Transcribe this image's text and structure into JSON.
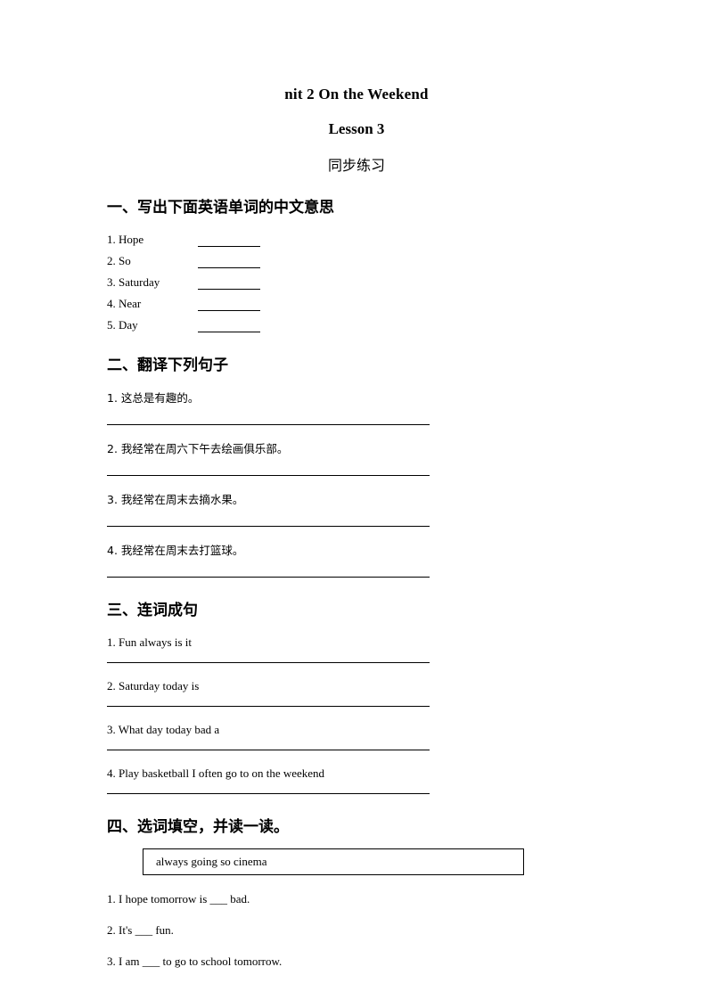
{
  "document": {
    "title": "nit 2 On the Weekend",
    "subtitle": "Lesson 3",
    "subtitle2": "同步练习"
  },
  "section1": {
    "heading": "一、写出下面英语单词的中文意思",
    "items": [
      {
        "number": "1.",
        "word": "Hope"
      },
      {
        "number": "2.",
        "word": "So"
      },
      {
        "number": "3.",
        "word": "Saturday"
      },
      {
        "number": "4.",
        "word": "Near"
      },
      {
        "number": "5.",
        "word": "Day"
      }
    ]
  },
  "section2": {
    "heading": "二、翻译下列句子",
    "items": [
      "1. 这总是有趣的。",
      "2. 我经常在周六下午去绘画俱乐部。",
      "3. 我经常在周末去摘水果。",
      "4. 我经常在周末去打篮球。"
    ]
  },
  "section3": {
    "heading": "三、连词成句",
    "items": [
      "1. Fun always is it",
      "2. Saturday today is",
      "3. What day today bad a",
      "4. Play basketball I often go to on the weekend"
    ]
  },
  "section4": {
    "heading": "四、选词填空，并读一读。",
    "wordbank": "always going so cinema",
    "items": [
      "1. I hope tomorrow is ___ bad.",
      "2. It's ___ fun.",
      "3. I am ___ to go to school tomorrow."
    ]
  }
}
